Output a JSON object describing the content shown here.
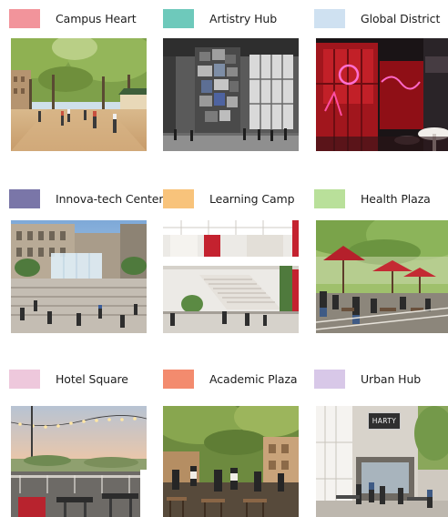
{
  "zones": [
    {
      "label": "Campus Heart",
      "swatch": "#f2949b"
    },
    {
      "label": "Artistry Hub",
      "swatch": "#6ec9bb"
    },
    {
      "label": "Global District",
      "swatch": "#cfe1f1"
    },
    {
      "label": "Innova-tech Center",
      "swatch": "#7a76a8"
    },
    {
      "label": "Learning Camp",
      "swatch": "#f8c37b"
    },
    {
      "label": "Health Plaza",
      "swatch": "#b9e09a"
    },
    {
      "label": "Hotel Square",
      "swatch": "#eec8dc"
    },
    {
      "label": "Academic Plaza",
      "swatch": "#f38b6e"
    },
    {
      "label": "Urban Hub",
      "swatch": "#d8c8e8"
    }
  ],
  "photos": {
    "urban_hub_sign": "HARTY"
  }
}
